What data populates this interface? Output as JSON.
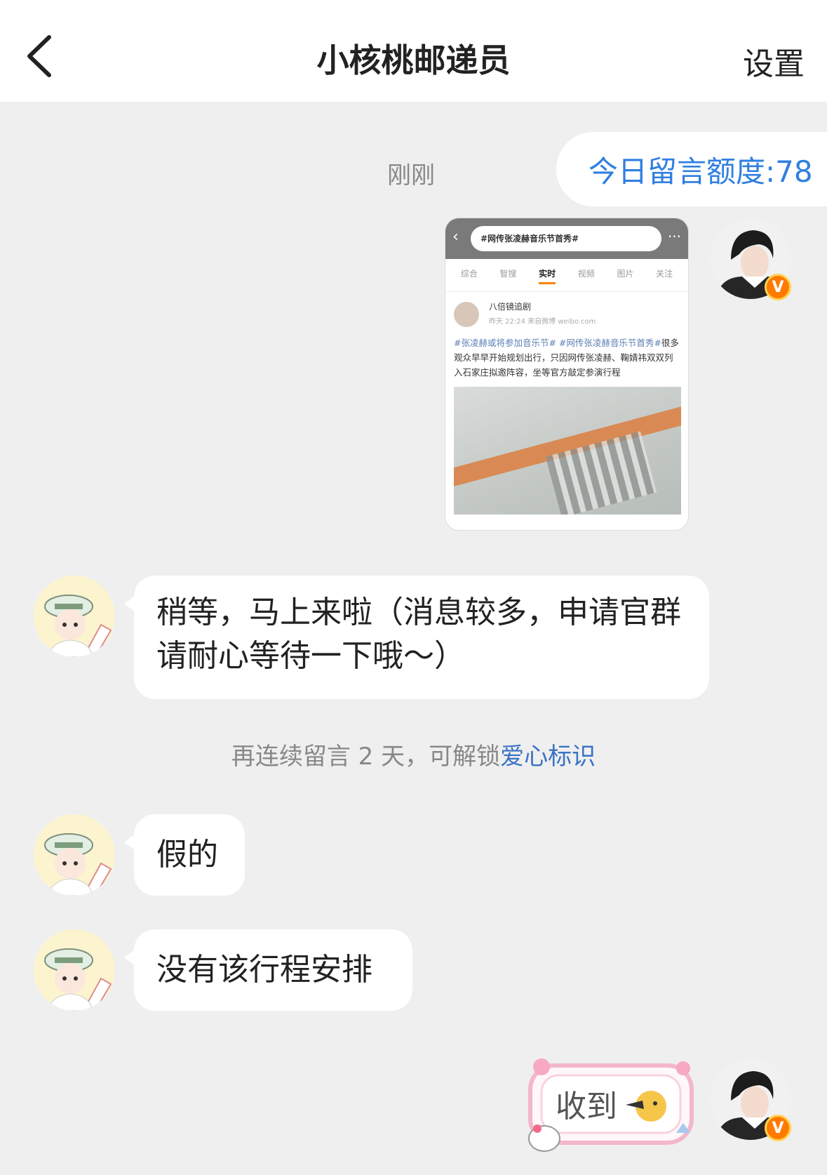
{
  "header": {
    "title": "小核桃邮递员",
    "settings_label": "设置"
  },
  "chat": {
    "timestamp": "刚刚",
    "quota_label": "今日留言额度:78",
    "screenshot_card": {
      "search_query": "#网传张凌赫音乐节首秀#",
      "tabs": [
        "综合",
        "智搜",
        "实时",
        "视频",
        "图片",
        "关注"
      ],
      "active_tab": "实时",
      "post_author": "八倍镜追剧",
      "post_meta": "昨天 22:24  来自微博 weibo.com",
      "post_tags": "#张凌赫或将参加音乐节# #网传张凌赫音乐节首秀#",
      "post_body": "很多观众早早开始规划出行，只因网传张凌赫、鞠婧祎双双列入石家庄拟邀阵容，坐等官方敲定参演行程"
    },
    "messages": [
      {
        "text": "稍等，马上来啦（消息较多，申请官群请耐心等待一下哦～）"
      },
      {
        "text": "假的"
      },
      {
        "text": "没有该行程安排"
      }
    ],
    "system_note": {
      "prefix": "再连续留言 2 天，可解锁",
      "link": "爱心标识"
    },
    "sticker_text": "收到",
    "badge_letter": "V"
  }
}
